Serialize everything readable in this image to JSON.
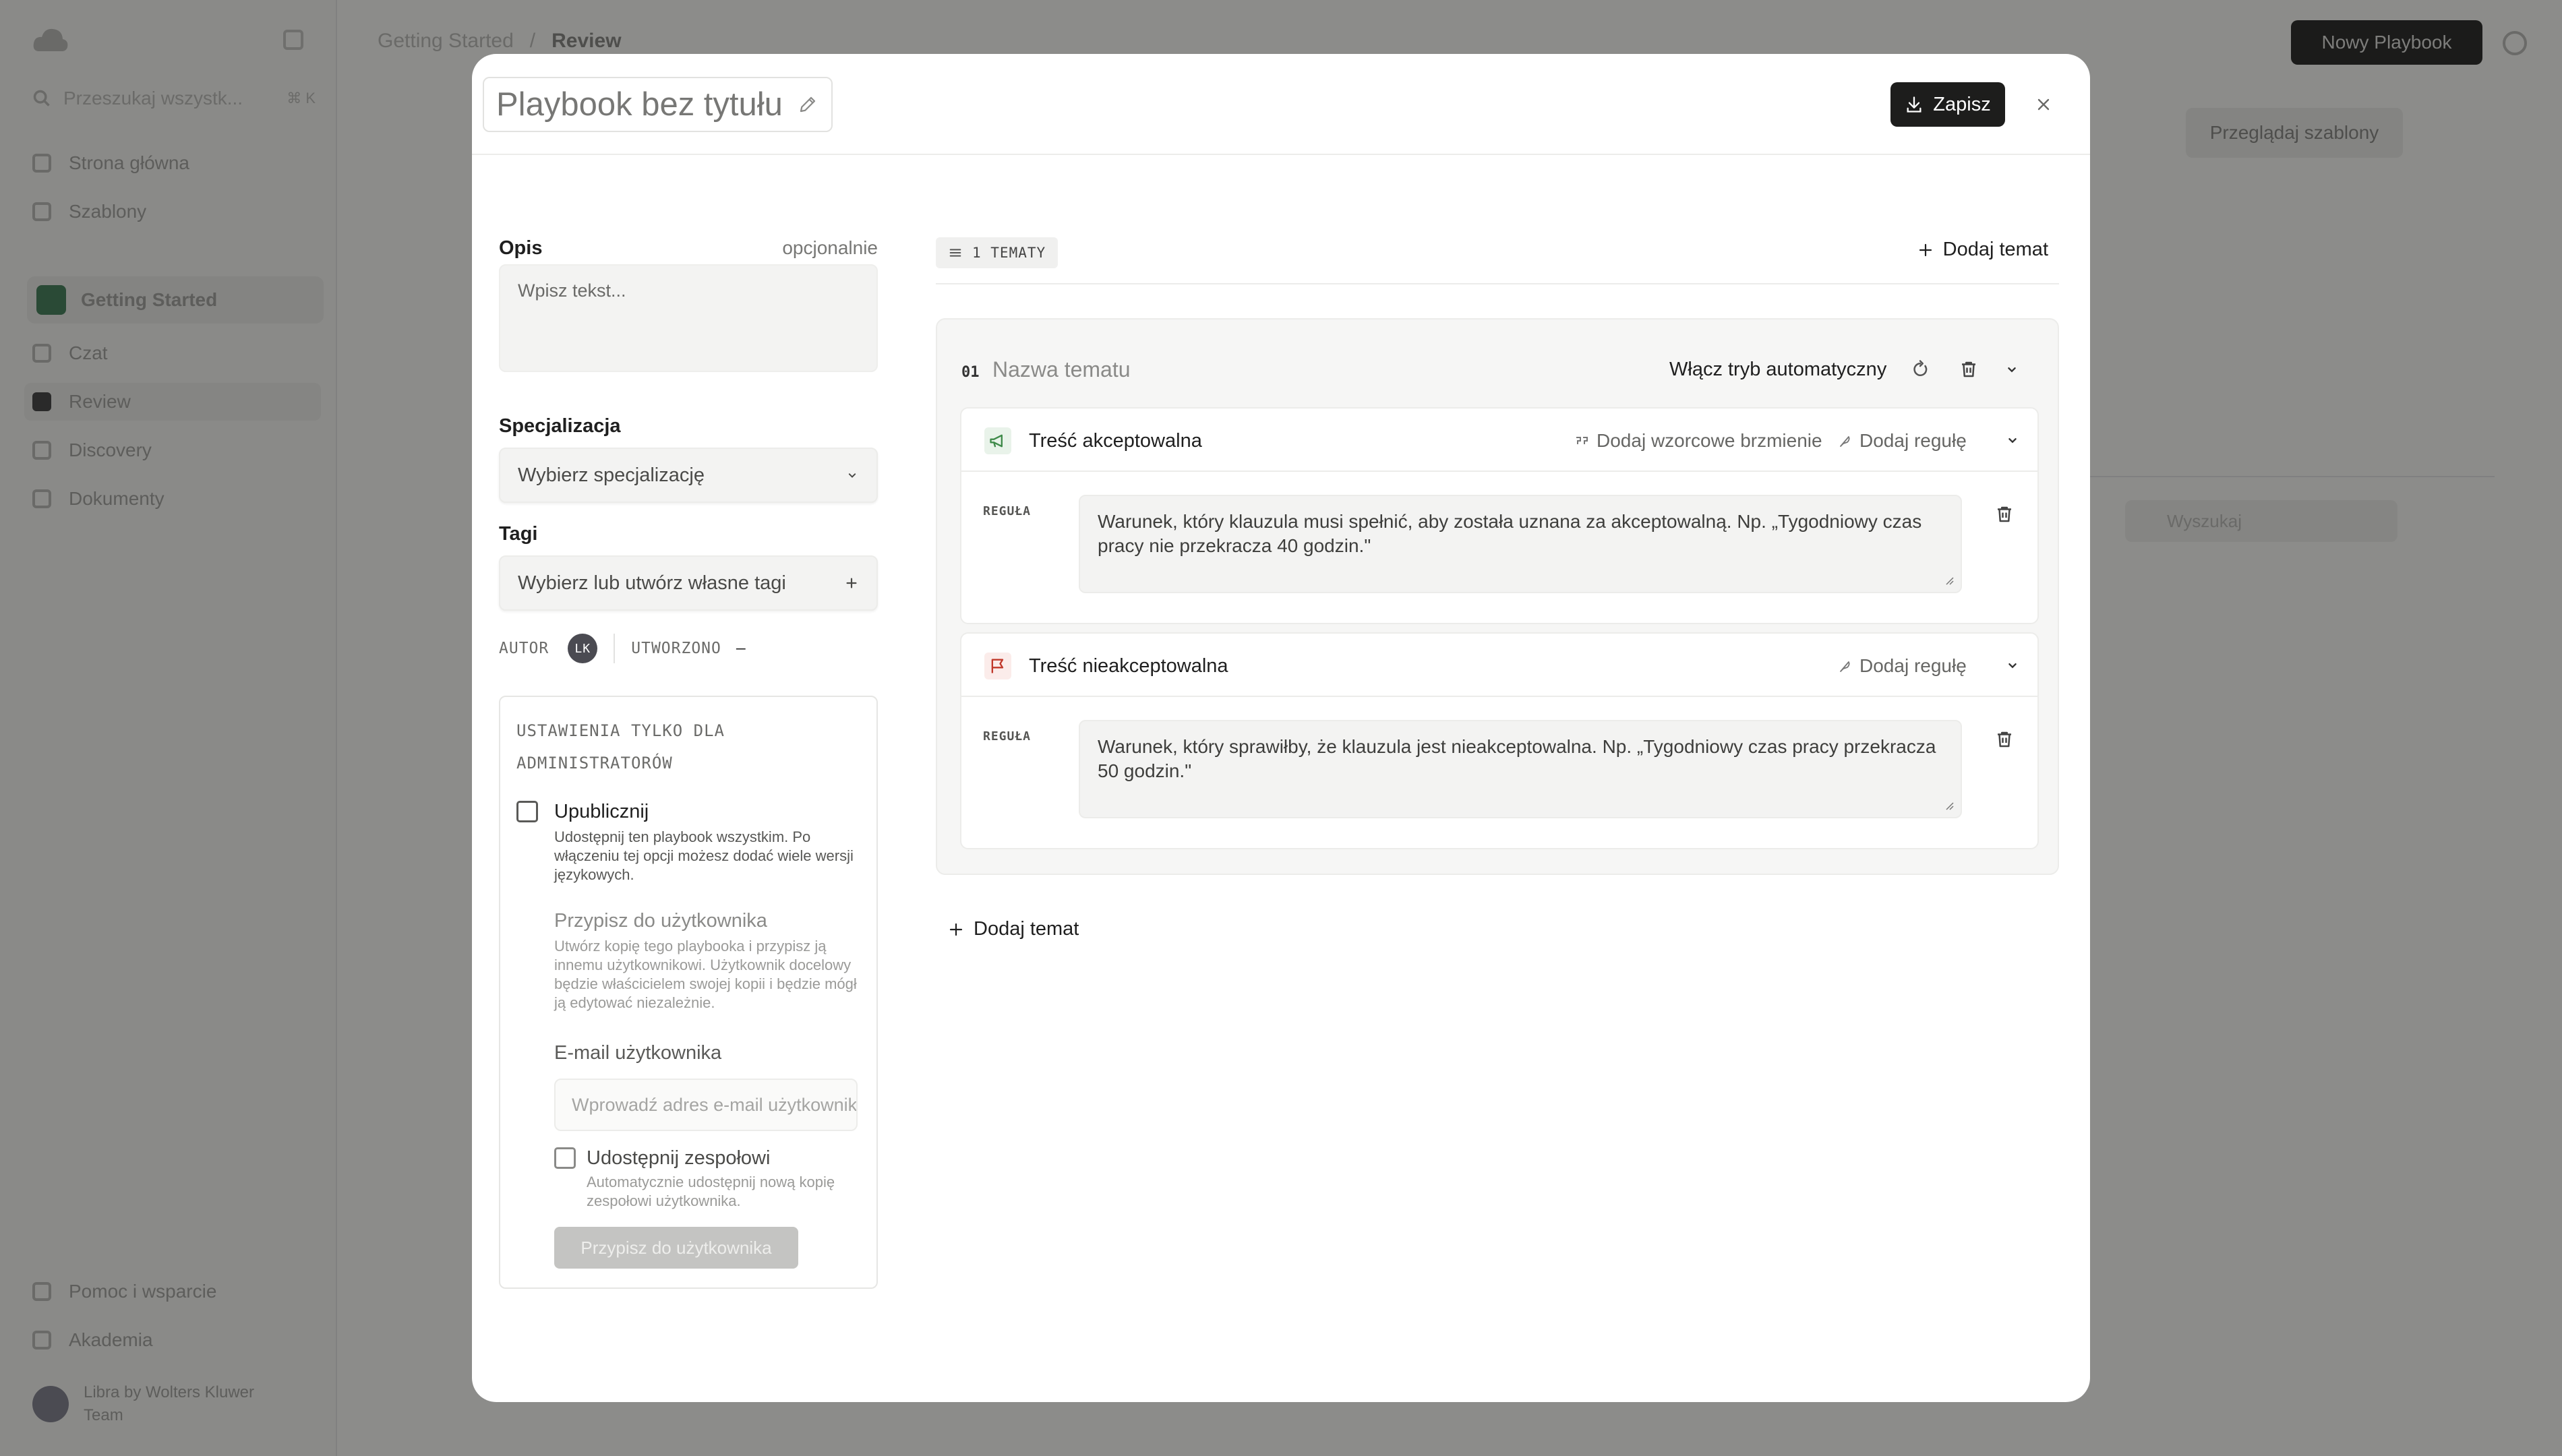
{
  "background": {
    "search_placeholder": "Przeszukaj wszystk...",
    "search_shortcut": "⌘ K",
    "nav_items": [
      {
        "label": "Strona główna"
      },
      {
        "label": "Szablony"
      }
    ],
    "workspace": {
      "label": "Getting Started"
    },
    "workspace_items": [
      {
        "label": "Czat"
      },
      {
        "label": "Review"
      },
      {
        "label": "Discovery"
      },
      {
        "label": "Dokumenty"
      }
    ],
    "footer_items": [
      {
        "label": "Pomoc i wsparcie"
      },
      {
        "label": "Akademia"
      }
    ],
    "user": {
      "name": "Libra by Wolters Kluwer",
      "plan": "Team"
    },
    "breadcrumb": {
      "parent": "Getting Started",
      "current": "Review"
    },
    "new_playbook_label": "Nowy Playbook",
    "templates_label": "Przeglądaj szablony",
    "filter_placeholder": "Wyszukaj"
  },
  "modal": {
    "title": "Playbook bez tytułu",
    "save_label": "Zapisz",
    "left": {
      "description_label": "Opis",
      "description_optional": "opcjonalnie",
      "description_placeholder": "Wpisz tekst...",
      "specialization_label": "Specjalizacja",
      "specialization_placeholder": "Wybierz specjalizację",
      "tags_label": "Tagi",
      "tags_placeholder": "Wybierz lub utwórz własne tagi",
      "author_label": "AUTOR",
      "author_initials": "LK",
      "created_label": "UTWORZONO",
      "created_value": "–",
      "admin": {
        "title": "USTAWIENIA TYLKO DLA ADMINISTRATORÓW",
        "public_label": "Upublicznij",
        "public_desc": "Udostępnij ten playbook wszystkim. Po włączeniu tej opcji możesz dodać wiele wersji językowych.",
        "assign_title": "Przypisz do użytkownika",
        "assign_desc": "Utwórz kopię tego playbooka i przypisz ją innemu użytkownikowi. Użytkownik docelowy będzie właścicielem swojej kopii i będzie mógł ją edytować niezależnie.",
        "email_label": "E-mail użytkownika",
        "email_placeholder": "Wprowadź adres e-mail użytkownika",
        "team_label": "Udostępnij zespołowi",
        "team_desc": "Automatycznie udostępnij nową kopię zespołowi użytkownika.",
        "assign_button": "Przypisz do użytkownika"
      }
    },
    "right": {
      "topics_count": "1 TEMATY",
      "add_topic_label": "Dodaj temat",
      "topic": {
        "number": "01",
        "name_placeholder": "Nazwa tematu",
        "auto_mode_label": "Włącz tryb automatyczny",
        "acceptable": {
          "title": "Treść akceptowalna",
          "add_sample_label": "Dodaj wzorcowe brzmienie",
          "add_rule_label": "Dodaj regułę",
          "rule_label": "REGUŁA",
          "rule_placeholder": "Warunek, który klauzula musi spełnić, aby została uznana za akceptowalną. Np. „Tygodniowy czas pracy nie przekracza 40 godzin.\""
        },
        "unacceptable": {
          "title": "Treść nieakceptowalna",
          "add_rule_label": "Dodaj regułę",
          "rule_label": "REGUŁA",
          "rule_placeholder": "Warunek, który sprawiłby, że klauzula jest nieakceptowalna. Np. „Tygodniowy czas pracy przekracza 50 godzin.\""
        }
      },
      "add_topic_bottom_label": "Dodaj temat"
    }
  },
  "colors": {
    "overlay": "#8c8c8a",
    "primary_button": "#1d1d1c",
    "acceptable_icon": "#3f8a4a",
    "unacceptable_icon": "#c0392b"
  }
}
